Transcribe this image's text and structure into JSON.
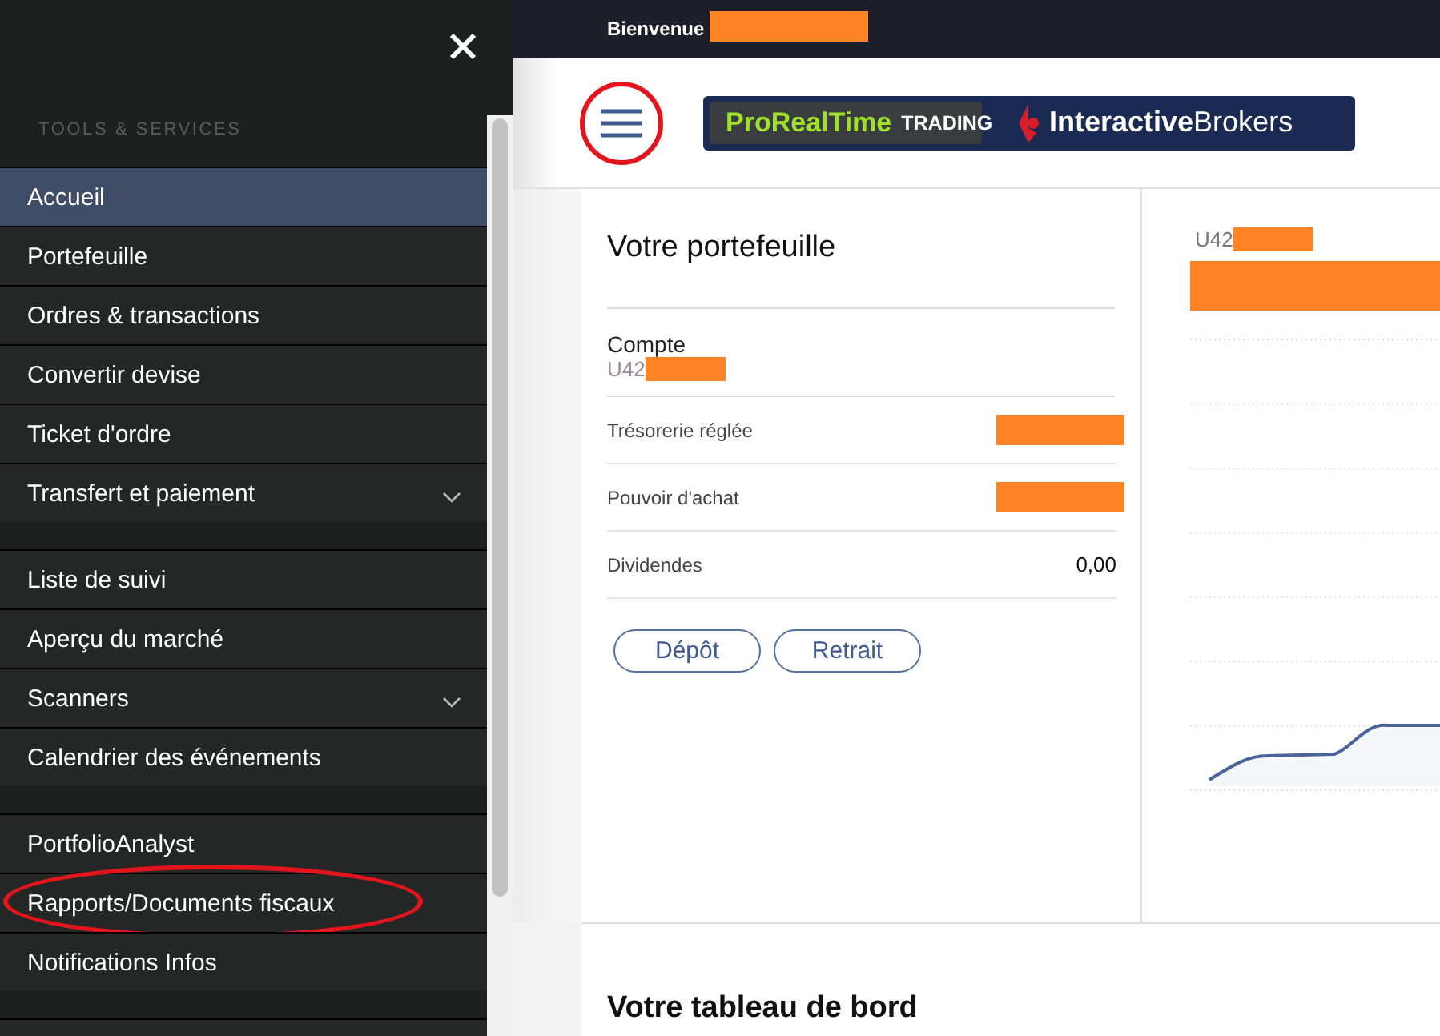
{
  "top_bar": {
    "greeting": "Bienvenue",
    "name_redacted": true
  },
  "sidebar": {
    "section_title": "TOOLS & SERVICES",
    "groups": [
      [
        {
          "label": "Accueil",
          "selected": true,
          "expandable": false,
          "highlighted": false
        },
        {
          "label": "Portefeuille",
          "selected": false,
          "expandable": false,
          "highlighted": false
        },
        {
          "label": "Ordres & transactions",
          "selected": false,
          "expandable": false,
          "highlighted": false
        },
        {
          "label": "Convertir devise",
          "selected": false,
          "expandable": false,
          "highlighted": false
        },
        {
          "label": "Ticket d'ordre",
          "selected": false,
          "expandable": false,
          "highlighted": false
        },
        {
          "label": "Transfert et paiement",
          "selected": false,
          "expandable": true,
          "highlighted": false
        }
      ],
      [
        {
          "label": "Liste de suivi",
          "selected": false,
          "expandable": false,
          "highlighted": false
        },
        {
          "label": "Aperçu du marché",
          "selected": false,
          "expandable": false,
          "highlighted": false
        },
        {
          "label": "Scanners",
          "selected": false,
          "expandable": true,
          "highlighted": false
        },
        {
          "label": "Calendrier des événements",
          "selected": false,
          "expandable": false,
          "highlighted": false
        }
      ],
      [
        {
          "label": "PortfolioAnalyst",
          "selected": false,
          "expandable": false,
          "highlighted": false
        },
        {
          "label": "Rapports/Documents fiscaux",
          "selected": false,
          "expandable": false,
          "highlighted": true
        },
        {
          "label": "Notifications Infos",
          "selected": false,
          "expandable": false,
          "highlighted": false
        }
      ]
    ]
  },
  "header": {
    "menu_button": {
      "highlighted": true
    },
    "logo": {
      "brand_1": "ProRealTime",
      "brand_1_suffix": "TRADING",
      "brand_2_bold": "Interactive",
      "brand_2": "Brokers"
    }
  },
  "portfolio": {
    "title": "Votre portefeuille",
    "account_label": "Compte",
    "account_id": "U42",
    "account_id_redacted": true,
    "rows": [
      {
        "label": "Trésorerie réglée",
        "value": "",
        "redacted": true
      },
      {
        "label": "Pouvoir d'achat",
        "value": "",
        "redacted": true
      },
      {
        "label": "Dividendes",
        "value": "0,00",
        "redacted": false
      }
    ],
    "buttons": [
      "Dépôt",
      "Retrait"
    ]
  },
  "chart_panel": {
    "account_id": "U42",
    "account_id_redacted": true,
    "value_redacted": true
  },
  "dashboard": {
    "title": "Votre tableau de bord"
  }
}
